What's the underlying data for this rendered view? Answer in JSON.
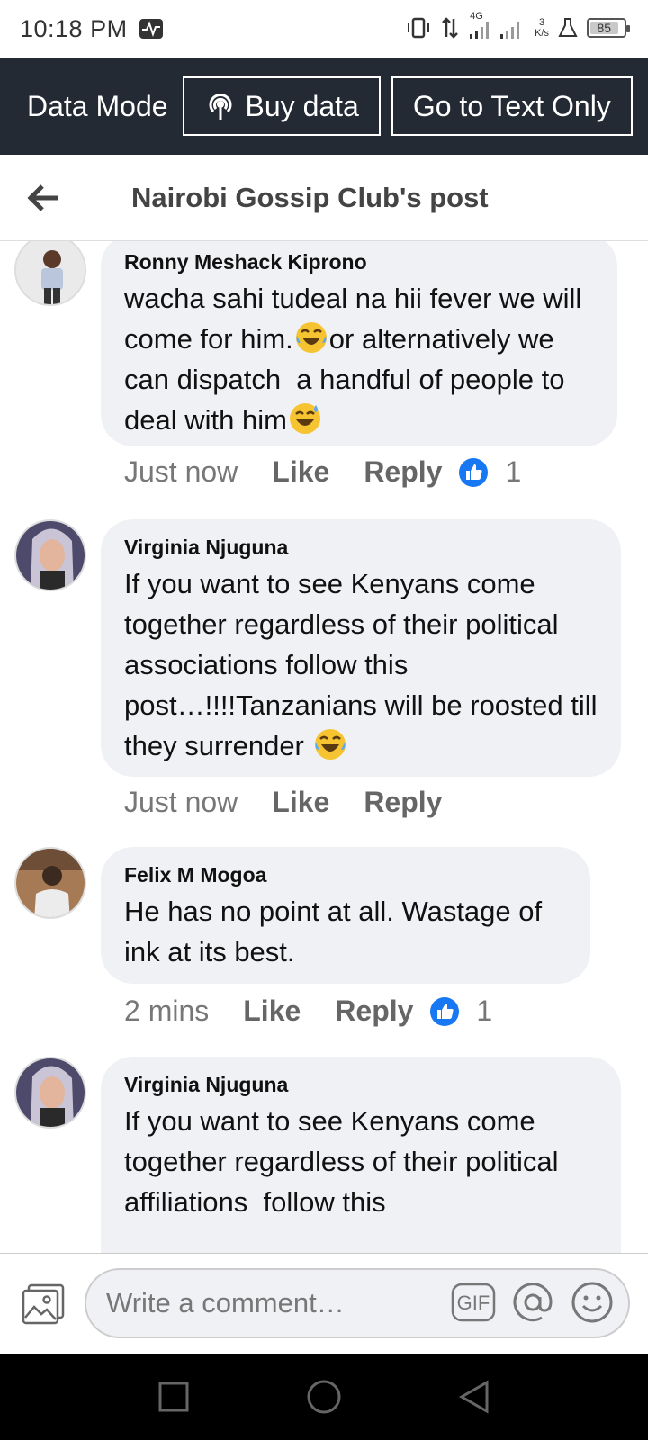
{
  "status_bar": {
    "time": "10:18 PM",
    "network": "4G",
    "speed_value": "3",
    "speed_unit": "K/s",
    "battery": "85",
    "battery_level": 0.85
  },
  "data_banner": {
    "label": "Data Mode",
    "buy_data": "Buy data",
    "text_only": "Go to Text Only"
  },
  "header": {
    "title": "Nairobi Gossip Club's post"
  },
  "comments": [
    {
      "author": "Ronny Meshack Kiprono",
      "text_parts": [
        "wacha sahi tudeal na hii fever we will come for him.",
        "or alternatively we can dispatch  a handful of people to deal with him"
      ],
      "emojis": [
        "laughing-tears-emoji",
        "sweat-smile-emoji"
      ],
      "time": "Just now",
      "like": "Like",
      "reply": "Reply",
      "reactions": "1"
    },
    {
      "author": "Virginia Njuguna",
      "text": "If you want to see Kenyans come together regardless of their political associations follow this post…!!!!Tanzanians will be roosted till they surrender ",
      "emojis": [
        "laughing-tears-emoji"
      ],
      "time": "Just now",
      "like": "Like",
      "reply": "Reply"
    },
    {
      "author": "Felix M Mogoa",
      "text": "He has no point at all. Wastage of ink at its best.",
      "time": "2 mins",
      "like": "Like",
      "reply": "Reply",
      "reactions": "1"
    },
    {
      "author": "Virginia Njuguna",
      "text": "If you want to see Kenyans come together regardless of their political affiliations  follow this"
    }
  ],
  "composer": {
    "placeholder": "Write a comment…",
    "gif_label": "GIF"
  },
  "colors": {
    "banner_bg": "#242a33",
    "bubble_bg": "#f0f1f5",
    "like_blue": "#1877f2"
  }
}
